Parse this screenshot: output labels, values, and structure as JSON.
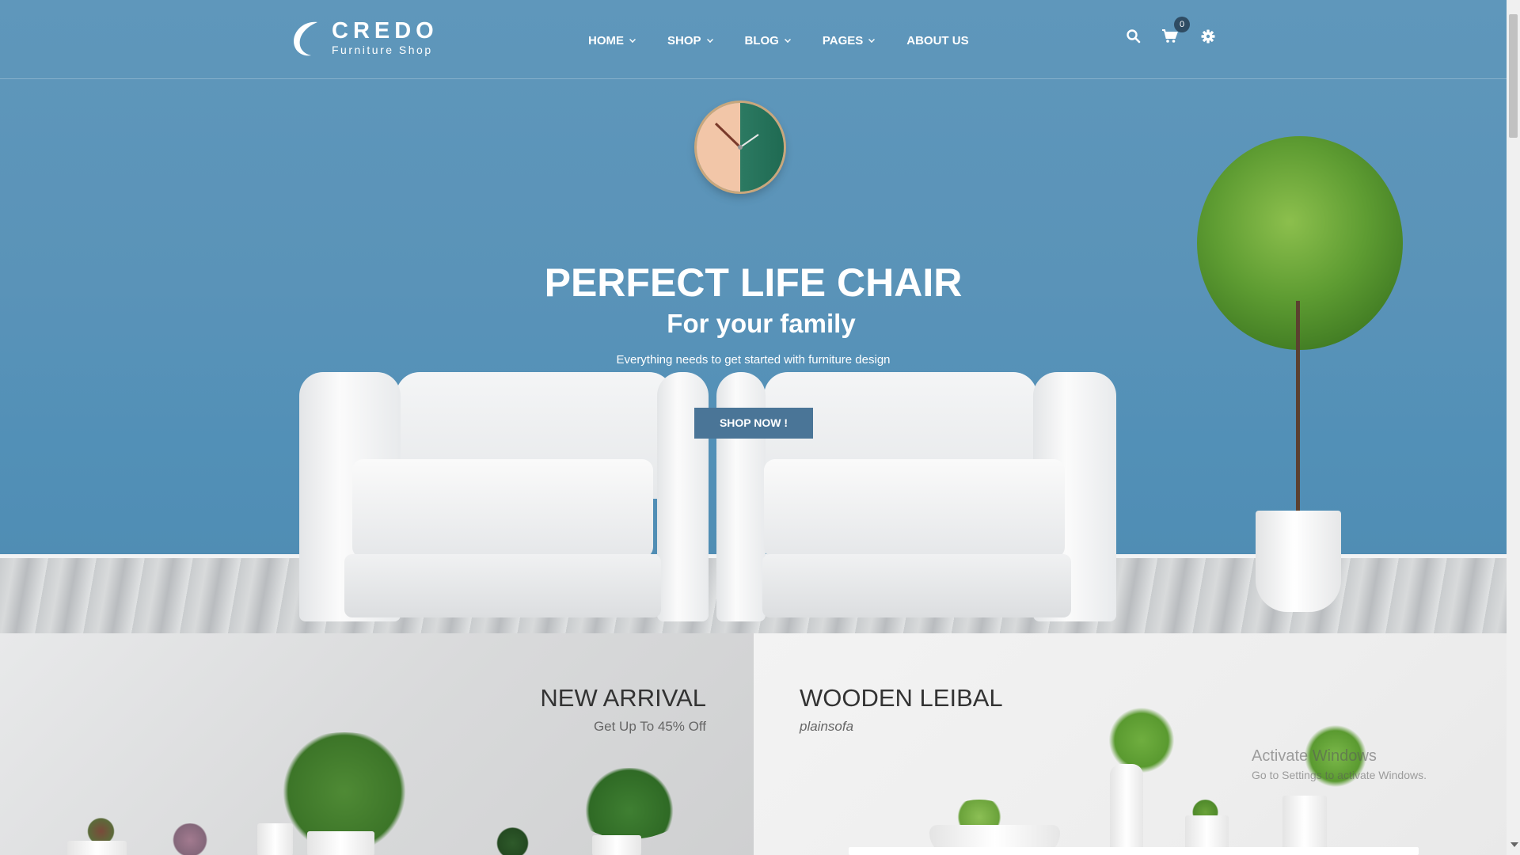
{
  "header": {
    "brand": "CREDO",
    "tagline": "Furniture Shop",
    "nav": [
      {
        "label": "HOME",
        "has_dropdown": true
      },
      {
        "label": "SHOP",
        "has_dropdown": true
      },
      {
        "label": "BLOG",
        "has_dropdown": true
      },
      {
        "label": "PAGES",
        "has_dropdown": true
      },
      {
        "label": "ABOUT US",
        "has_dropdown": false
      }
    ],
    "icons": [
      "search-icon",
      "cart-icon",
      "gear-icon"
    ],
    "cart_count": "0"
  },
  "hero": {
    "title": "PERFECT LIFE CHAIR",
    "subtitle": "For your family",
    "description": "Everything needs to get started with furniture design",
    "button": "SHOP NOW !"
  },
  "banners": {
    "left": {
      "title": "NEW ARRIVAL",
      "subtitle": "Get Up To 45% Off"
    },
    "right": {
      "title": "WOODEN LEIBAL",
      "subtitle": "plainsofa"
    }
  },
  "watermark": {
    "line1": "Activate Windows",
    "line2": "Go to Settings to activate Windows."
  },
  "colors": {
    "hero_bg": "#5a93b8",
    "button_bg": "#4a7597",
    "badge_bg": "#2f4c63"
  }
}
